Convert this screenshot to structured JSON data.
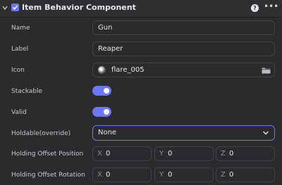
{
  "header": {
    "title": "Item Behavior Component",
    "help_icon": "?",
    "more_icon": "•••"
  },
  "fields": {
    "name": {
      "label": "Name",
      "value": "Gun"
    },
    "label": {
      "label": "Label",
      "value": "Reaper"
    },
    "icon": {
      "label": "Icon",
      "value": "flare_005"
    },
    "stackable": {
      "label": "Stackable",
      "value": "on"
    },
    "valid": {
      "label": "Valid",
      "value": "on"
    },
    "holdable": {
      "label": "Holdable(override)",
      "value": "None"
    },
    "holding_offset_position": {
      "label": "Holding Offset Position",
      "x_axis": "X",
      "x": "0",
      "y_axis": "Y",
      "y": "0",
      "z_axis": "Z",
      "z": "0"
    },
    "holding_offset_rotation": {
      "label": "Holding Offset Rotation",
      "x_axis": "X",
      "x": "0",
      "y_axis": "Y",
      "y": "0",
      "z_axis": "Z",
      "z": "0"
    }
  },
  "colors": {
    "accent": "#6b78f5",
    "background": "#2b2b2d"
  }
}
